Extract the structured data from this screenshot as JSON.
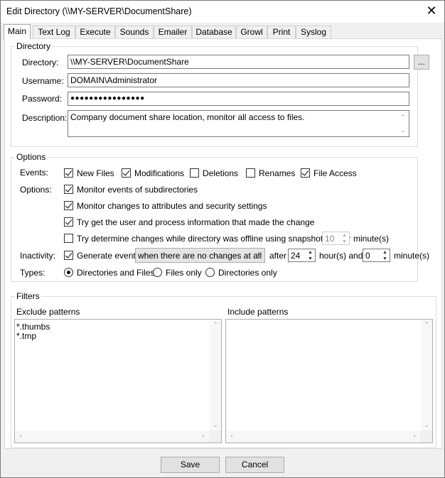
{
  "window": {
    "title": "Edit Directory (\\\\MY-SERVER\\DocumentShare)"
  },
  "tabs": [
    {
      "label": "Main"
    },
    {
      "label": "Text Log"
    },
    {
      "label": "Execute"
    },
    {
      "label": "Sounds"
    },
    {
      "label": "Emailer"
    },
    {
      "label": "Database"
    },
    {
      "label": "Growl"
    },
    {
      "label": "Print"
    },
    {
      "label": "Syslog"
    }
  ],
  "directory": {
    "group_label": "Directory",
    "directory_label": "Directory:",
    "directory_value": "\\\\MY-SERVER\\DocumentShare",
    "browse_label": "...",
    "username_label": "Username:",
    "username_value": "DOMAIN\\Administrator",
    "password_label": "Password:",
    "password_value": "●●●●●●●●●●●●●●●●",
    "description_label": "Description:",
    "description_value": "Company document share location, monitor all access to files."
  },
  "options": {
    "group_label": "Options",
    "events_label": "Events:",
    "events": [
      {
        "label": "New Files",
        "checked": true
      },
      {
        "label": "Modifications",
        "checked": true
      },
      {
        "label": "Deletions",
        "checked": false
      },
      {
        "label": "Renames",
        "checked": false
      },
      {
        "label": "File Access",
        "checked": true
      }
    ],
    "options_label": "Options:",
    "opt_subdirs": {
      "label": "Monitor events of subdirectories",
      "checked": true
    },
    "opt_attributes": {
      "label": "Monitor changes to attributes and security settings",
      "checked": true
    },
    "opt_user": {
      "label": "Try get the user and process information that made the change",
      "checked": true
    },
    "opt_offline": {
      "label": "Try determine changes while directory was offline using snapshots every",
      "checked": false,
      "value": "10",
      "unit": "minute(s)"
    },
    "inactivity_label": "Inactivity:",
    "inactivity": {
      "label": "Generate event",
      "checked": true,
      "condition": "when there are no changes at all",
      "after_label": "after",
      "hours": "24",
      "hours_unit": "hour(s) and",
      "minutes": "0",
      "minutes_unit": "minute(s)"
    },
    "types_label": "Types:",
    "types": [
      {
        "label": "Directories and Files",
        "selected": true
      },
      {
        "label": "Files only",
        "selected": false
      },
      {
        "label": "Directories only",
        "selected": false
      }
    ]
  },
  "filters": {
    "group_label": "Filters",
    "exclude_label": "Exclude patterns",
    "exclude_items": [
      "*.thumbs",
      "*.tmp"
    ],
    "include_label": "Include patterns",
    "include_items": []
  },
  "footer": {
    "save_label": "Save",
    "cancel_label": "Cancel"
  }
}
